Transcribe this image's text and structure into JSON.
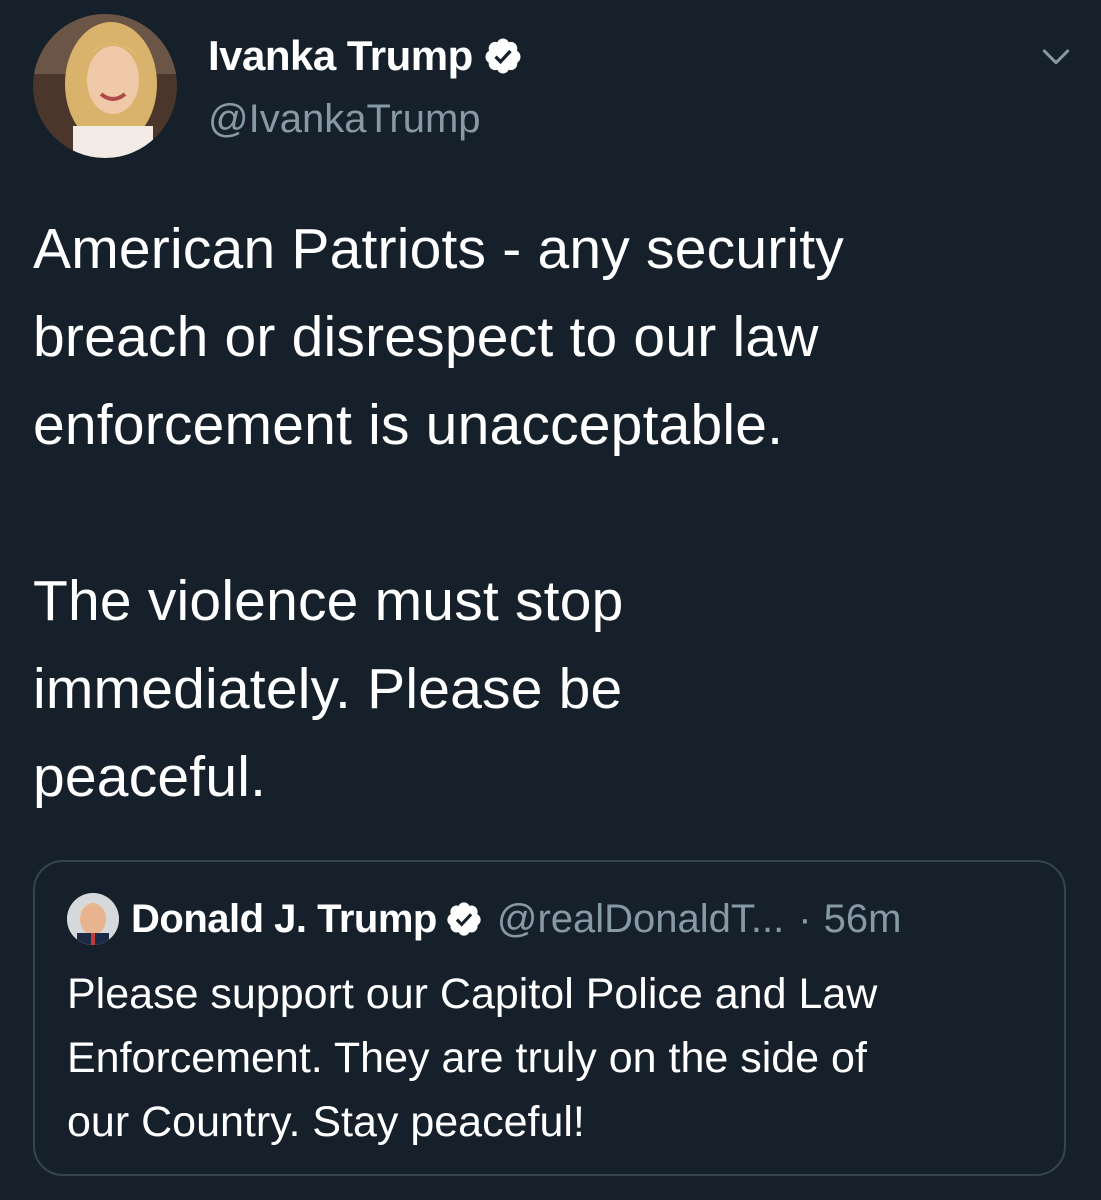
{
  "tweet": {
    "author": {
      "name": "Ivanka Trump",
      "handle": "@IvankaTrump",
      "verified": true,
      "avatar_icon": "profile-photo"
    },
    "menu_icon": "chevron-down-icon",
    "text": "American Patriots - any security\nbreach or disrespect to our law\nenforcement is unacceptable.\n\nThe violence must stop\nimmediately. Please be\npeaceful."
  },
  "quoted_tweet": {
    "author": {
      "name": "Donald J. Trump",
      "handle": "@realDonaldT...",
      "verified": true,
      "avatar_icon": "profile-photo"
    },
    "separator": "·",
    "time": "56m",
    "text": "Please support our Capitol Police and Law\nEnforcement. They are truly on the side of\nour Country. Stay peaceful!"
  },
  "colors": {
    "background": "#15202b",
    "text_primary": "#ffffff",
    "text_secondary": "#8899a6",
    "border": "#38444d"
  }
}
